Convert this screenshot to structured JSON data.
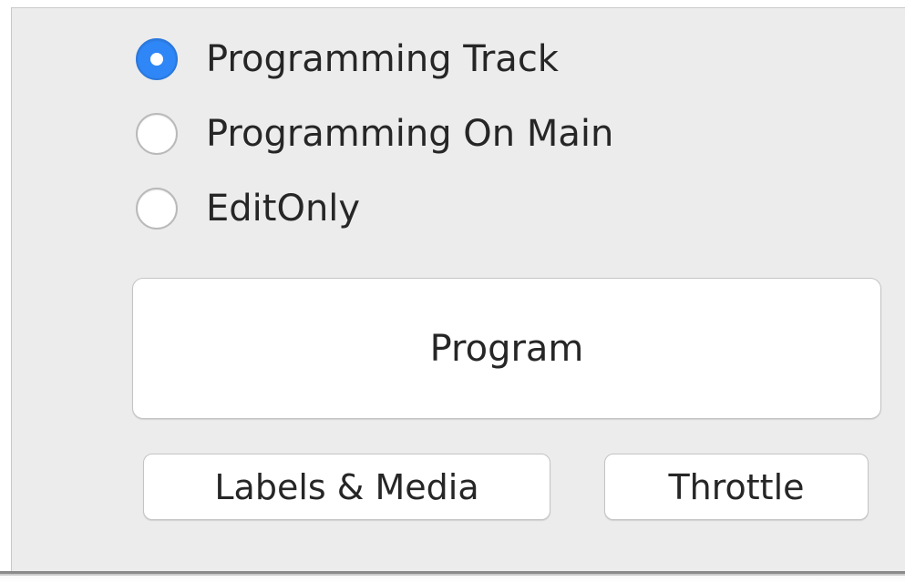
{
  "programming_mode": {
    "options": [
      {
        "label": "Programming Track",
        "selected": true
      },
      {
        "label": "Programming On Main",
        "selected": false
      },
      {
        "label": "EditOnly",
        "selected": false
      }
    ]
  },
  "actions": {
    "program_label": "Program",
    "labels_media_label": "Labels & Media",
    "throttle_label": "Throttle"
  },
  "colors": {
    "accent": "#2f86f6",
    "panel_background": "#ececec",
    "button_background": "#ffffff",
    "text": "#262626"
  }
}
